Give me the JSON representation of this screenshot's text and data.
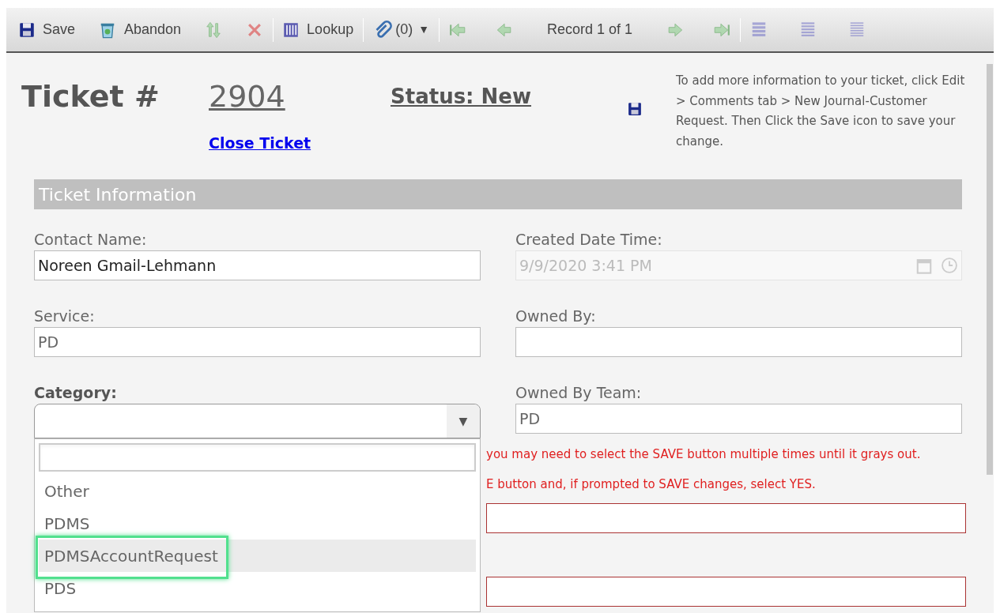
{
  "toolbar": {
    "save": "Save",
    "abandon": "Abandon",
    "lookup": "Lookup",
    "attachments": "(0)",
    "dropdown_arrow": "▼",
    "record": "Record 1 of 1"
  },
  "header": {
    "title": "Ticket #",
    "number": "2904",
    "status": "Status: New",
    "close_link": "Close Ticket",
    "note": "To add more information to your ticket, click Edit > Comments tab > New Journal-Customer Request. Then Click the Save icon to save your change."
  },
  "section": {
    "title": "Ticket Information"
  },
  "fields": [
    {
      "label": "Contact Name:",
      "value": "Noreen Gmail-Lehmann",
      "disabled": false
    },
    {
      "label": "Created Date Time:",
      "value": "9/9/2020 3:41 PM",
      "disabled": true,
      "kind": "datetime"
    },
    {
      "label": "Service:",
      "value": "PD",
      "disabled": false
    },
    {
      "label": "Owned By:",
      "disabled": false
    },
    {
      "label": "Category:",
      "kind": "dropdown",
      "expanded": true,
      "caret": "▼"
    },
    {
      "label": "Owned By Team:",
      "value": "PD",
      "disabled": false
    }
  ],
  "dropdown": {
    "options": [
      {
        "label": "Other",
        "selected": false
      },
      {
        "label": "PDMS",
        "selected": false
      },
      {
        "label": "PDMSAccountRequest",
        "selected": true
      },
      {
        "label": "PDS",
        "selected": false
      }
    ]
  },
  "warnings": [
    "you may need to select the SAVE button multiple times until it grays out.",
    "E button and, if prompted to SAVE changes, select YES."
  ]
}
